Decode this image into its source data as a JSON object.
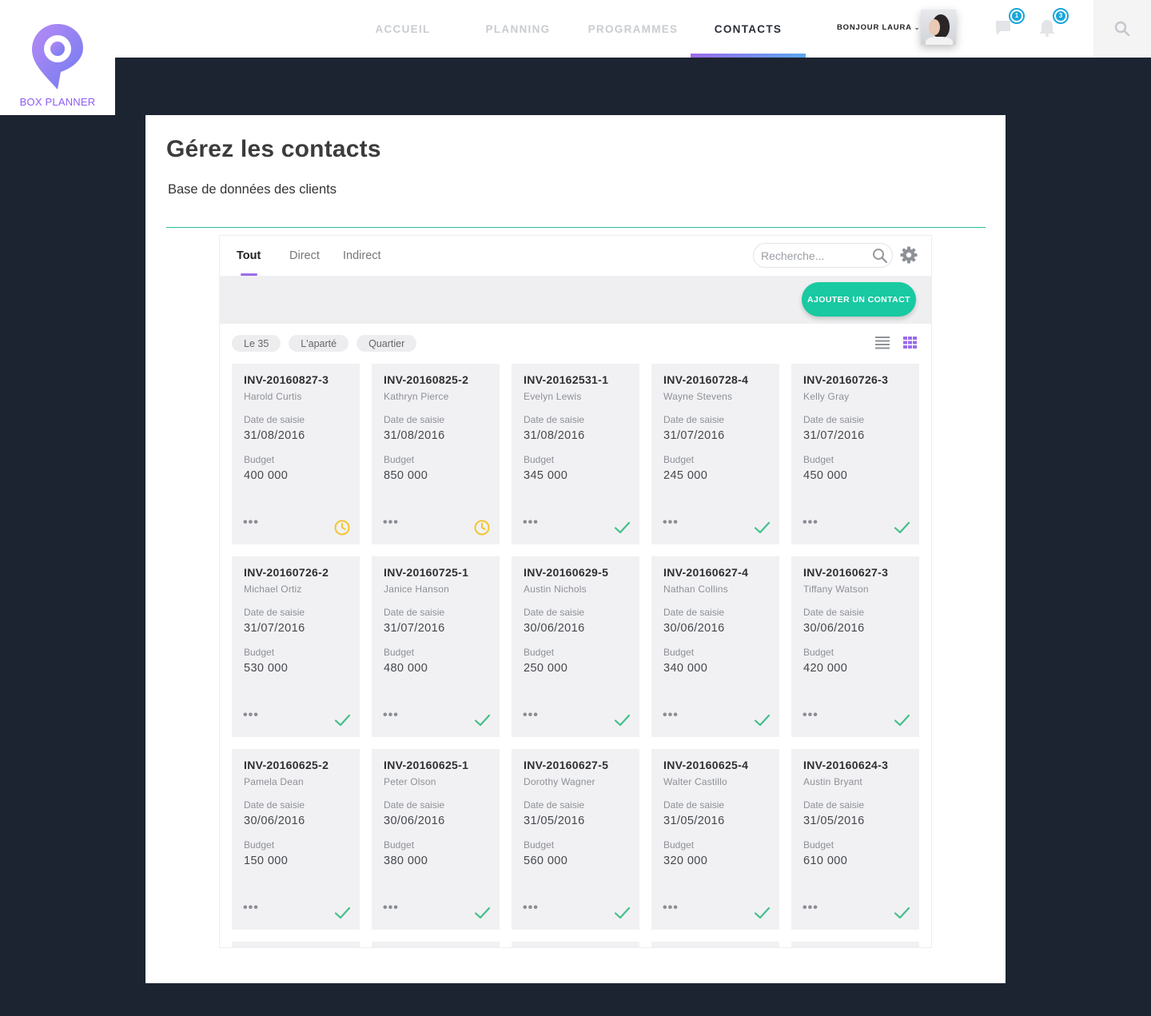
{
  "brand": {
    "name": "BOX PLANNER",
    "accent": "#8b5cf6"
  },
  "nav": {
    "items": [
      {
        "label": "ACCUEIL",
        "active": false
      },
      {
        "label": "PLANNING",
        "active": false
      },
      {
        "label": "PROGRAMMES",
        "active": false
      },
      {
        "label": "CONTACTS",
        "active": true
      }
    ]
  },
  "user": {
    "greeting": "BONJOUR LAURA",
    "messages_count": "1",
    "notifications_count": "3"
  },
  "page": {
    "title": "Gérez les contacts",
    "subtitle": "Base de données des clients"
  },
  "tabs": [
    {
      "label": "Tout",
      "active": true
    },
    {
      "label": "Direct",
      "active": false
    },
    {
      "label": "Indirect",
      "active": false
    }
  ],
  "search": {
    "placeholder": "Recherche..."
  },
  "actions": {
    "add_contact": "AJOUTER UN CONTACT",
    "add_color": "#18c9a1"
  },
  "filters": [
    "Le 35",
    "L'aparté",
    "Quartier"
  ],
  "card_labels": {
    "date": "Date de saisie",
    "budget": "Budget",
    "more": "•••"
  },
  "status_colors": {
    "pending": "#f3c530",
    "done": "#43c08a"
  },
  "cards": [
    {
      "id": "INV-20160827-3",
      "name": "Harold Curtis",
      "date": "31/08/2016",
      "budget": "400 000",
      "status": "pending"
    },
    {
      "id": "INV-20160825-2",
      "name": "Kathryn Pierce",
      "date": "31/08/2016",
      "budget": "850 000",
      "status": "pending"
    },
    {
      "id": "INV-20162531-1",
      "name": "Evelyn Lewis",
      "date": "31/08/2016",
      "budget": "345 000",
      "status": "done"
    },
    {
      "id": "INV-20160728-4",
      "name": "Wayne Stevens",
      "date": "31/07/2016",
      "budget": "245 000",
      "status": "done"
    },
    {
      "id": "INV-20160726-3",
      "name": "Kelly Gray",
      "date": "31/07/2016",
      "budget": "450 000",
      "status": "done"
    },
    {
      "id": "INV-20160726-2",
      "name": "Michael Ortiz",
      "date": "31/07/2016",
      "budget": "530 000",
      "status": "done"
    },
    {
      "id": "INV-20160725-1",
      "name": "Janice Hanson",
      "date": "31/07/2016",
      "budget": "480 000",
      "status": "done"
    },
    {
      "id": "INV-20160629-5",
      "name": "Austin Nichols",
      "date": "30/06/2016",
      "budget": "250 000",
      "status": "done"
    },
    {
      "id": "INV-20160627-4",
      "name": "Nathan Collins",
      "date": "30/06/2016",
      "budget": "340 000",
      "status": "done"
    },
    {
      "id": "INV-20160627-3",
      "name": "Tiffany Watson",
      "date": "30/06/2016",
      "budget": "420 000",
      "status": "done"
    },
    {
      "id": "INV-20160625-2",
      "name": "Pamela Dean",
      "date": "30/06/2016",
      "budget": "150 000",
      "status": "done"
    },
    {
      "id": "INV-20160625-1",
      "name": "Peter Olson",
      "date": "30/06/2016",
      "budget": "380 000",
      "status": "done"
    },
    {
      "id": "INV-20160627-5",
      "name": "Dorothy Wagner",
      "date": "31/05/2016",
      "budget": "560 000",
      "status": "done"
    },
    {
      "id": "INV-20160625-4",
      "name": "Walter Castillo",
      "date": "31/05/2016",
      "budget": "320 000",
      "status": "done"
    },
    {
      "id": "INV-20160624-3",
      "name": "Austin Bryant",
      "date": "31/05/2016",
      "budget": "610 000",
      "status": "done"
    }
  ]
}
